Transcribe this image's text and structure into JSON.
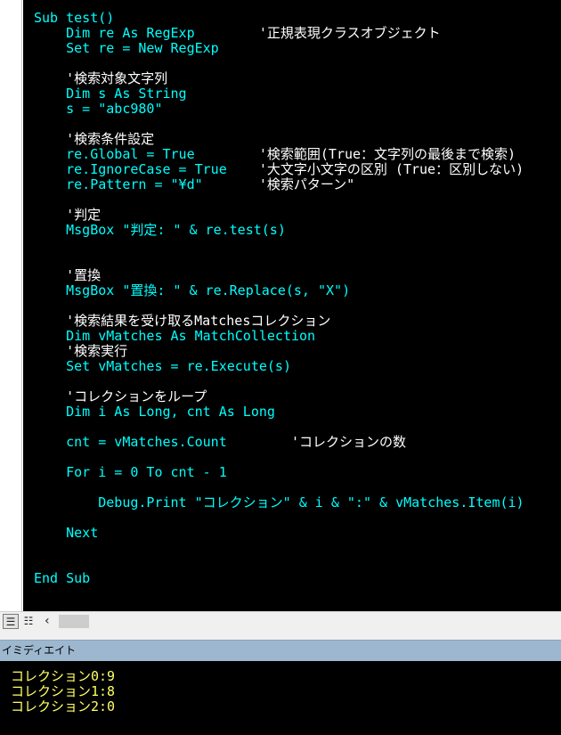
{
  "editor": {
    "lines": [
      [
        {
          "t": "Sub test()",
          "c": "kw"
        }
      ],
      [
        {
          "t": "    Dim re As RegExp        ",
          "c": "kw"
        },
        {
          "t": "'正規表現クラスオブジェクト",
          "c": "cmt"
        }
      ],
      [
        {
          "t": "    Set re = New RegExp",
          "c": "kw"
        }
      ],
      [],
      [
        {
          "t": "    '検索対象文字列",
          "c": "cmt"
        }
      ],
      [
        {
          "t": "    Dim s As String",
          "c": "kw"
        }
      ],
      [
        {
          "t": "    s = \"abc980\"",
          "c": "txt"
        }
      ],
      [],
      [
        {
          "t": "    '検索条件設定",
          "c": "cmt"
        }
      ],
      [
        {
          "t": "    re.Global = True        ",
          "c": "txt"
        },
        {
          "t": "'検索範囲(True：文字列の最後まで検索)",
          "c": "cmt"
        }
      ],
      [
        {
          "t": "    re.IgnoreCase = True    ",
          "c": "txt"
        },
        {
          "t": "'大文字小文字の区別 (True：区別しない)",
          "c": "cmt"
        }
      ],
      [
        {
          "t": "    re.Pattern = \"¥d\"       ",
          "c": "txt"
        },
        {
          "t": "'検索パターン\"",
          "c": "cmt"
        }
      ],
      [],
      [
        {
          "t": "    '判定",
          "c": "cmt"
        }
      ],
      [
        {
          "t": "    MsgBox \"判定: \" & re.test(s)",
          "c": "txt"
        }
      ],
      [],
      [],
      [
        {
          "t": "    '置換",
          "c": "cmt"
        }
      ],
      [
        {
          "t": "    MsgBox \"置換: \" & re.Replace(s, \"X\")",
          "c": "txt"
        }
      ],
      [],
      [
        {
          "t": "    '検索結果を受け取るMatchesコレクション",
          "c": "cmt"
        }
      ],
      [
        {
          "t": "    Dim vMatches As MatchCollection",
          "c": "kw"
        }
      ],
      [
        {
          "t": "    '検索実行",
          "c": "cmt"
        }
      ],
      [
        {
          "t": "    Set vMatches = re.Execute(s)",
          "c": "txt"
        }
      ],
      [],
      [
        {
          "t": "    'コレクションをループ",
          "c": "cmt"
        }
      ],
      [
        {
          "t": "    Dim i As Long, cnt As Long",
          "c": "kw"
        }
      ],
      [],
      [
        {
          "t": "    cnt = vMatches.Count        ",
          "c": "txt"
        },
        {
          "t": "'コレクションの数",
          "c": "cmt"
        }
      ],
      [],
      [
        {
          "t": "    For i = 0 To cnt - 1",
          "c": "kw"
        }
      ],
      [],
      [
        {
          "t": "        Debug.Print \"コレクション\" & i & \":\" & vMatches.Item(i)",
          "c": "txt"
        }
      ],
      [],
      [
        {
          "t": "    Next",
          "c": "kw"
        }
      ],
      [],
      [],
      [
        {
          "t": "End Sub",
          "c": "kw"
        }
      ]
    ]
  },
  "toolbar": {
    "view_procedure_icon": "proc-view-icon",
    "view_procedure_glyph": "☰",
    "view_full_icon": "full-module-view-icon",
    "view_full_glyph": "☷",
    "scroll_left_glyph": "‹"
  },
  "immediate": {
    "title": "イミディエイト",
    "lines": [
      "コレクション0:9",
      "コレクション1:8",
      "コレクション2:0"
    ]
  },
  "colors": {
    "code_background": "#000000",
    "keyword_text": "#00ffff",
    "comment_text": "#ffffff",
    "immediate_text": "#ffff66",
    "immediate_title_bar": "#9db7cf"
  }
}
